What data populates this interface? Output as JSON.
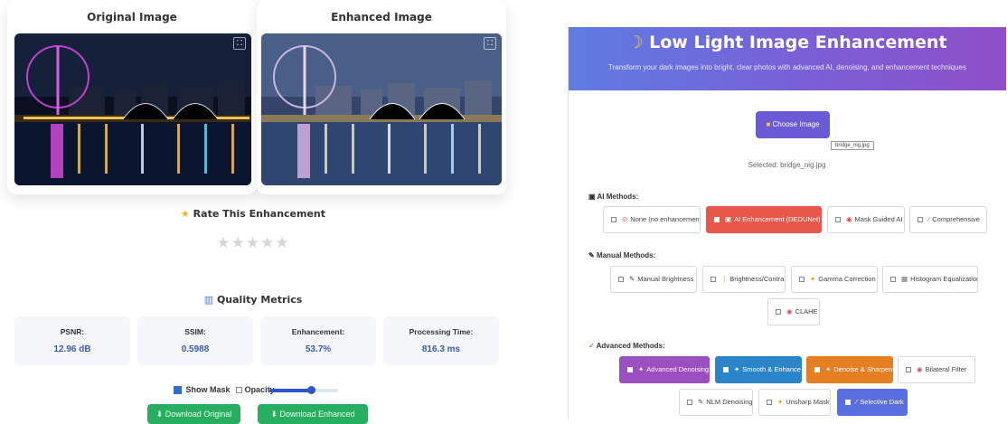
{
  "left": {
    "original_title": "Original Image",
    "enhanced_title": "Enhanced Image",
    "rate_title": "Rate This Enhancement",
    "rating": 0,
    "stars": "★★★★★",
    "metrics_title": "Quality Metrics",
    "metrics": [
      {
        "label": "PSNR:",
        "value": "12.96 dB"
      },
      {
        "label": "SSIM:",
        "value": "0.5988"
      },
      {
        "label": "Enhancement:",
        "value": "53.7%"
      },
      {
        "label": "Processing Time:",
        "value": "816.3 ms"
      }
    ],
    "show_mask_label": "Show Mask",
    "opacity_label": "Opacity",
    "opacity_value": 0.6,
    "download_original": "Download Original",
    "download_enhanced": "Download Enhanced"
  },
  "right": {
    "title": "Low Light Image Enhancement",
    "subtitle": "Transform your dark images into bright, clear photos with advanced AI, denoising, and enhancement techniques",
    "choose_label": "Choose Image",
    "tooltip": "bridge_nig.jpg",
    "selected_text": "Selected: bridge_nig.jpg",
    "ai_section": "AI Methods:",
    "ai_methods": [
      "None (no enhancement)",
      "AI Enhancement (DEDUNet)",
      "Mask Guided AI",
      "Comprehensive"
    ],
    "manual_section": "Manual Methods:",
    "manual_methods": [
      "Manual Brightness",
      "Brightness/Contrast",
      "Gamma Correction",
      "Histogram Equalization",
      "CLAHE"
    ],
    "advanced_section": "Advanced Methods:",
    "advanced_methods": [
      "Advanced Denoising",
      "Smooth & Enhance",
      "Denoise & Sharpen",
      "Bilateral Filter",
      "NLM Denoising",
      "Unsharp Mask",
      "Selective Dark"
    ]
  },
  "colors": {
    "ai_active": "#e8584a",
    "advanced_denoising": "#9b4fc0",
    "smooth_enhance": "#2a86c8",
    "denoise_sharpen": "#e67e22",
    "selective_dark": "#5b6ee0",
    "download": "#27ae60"
  }
}
